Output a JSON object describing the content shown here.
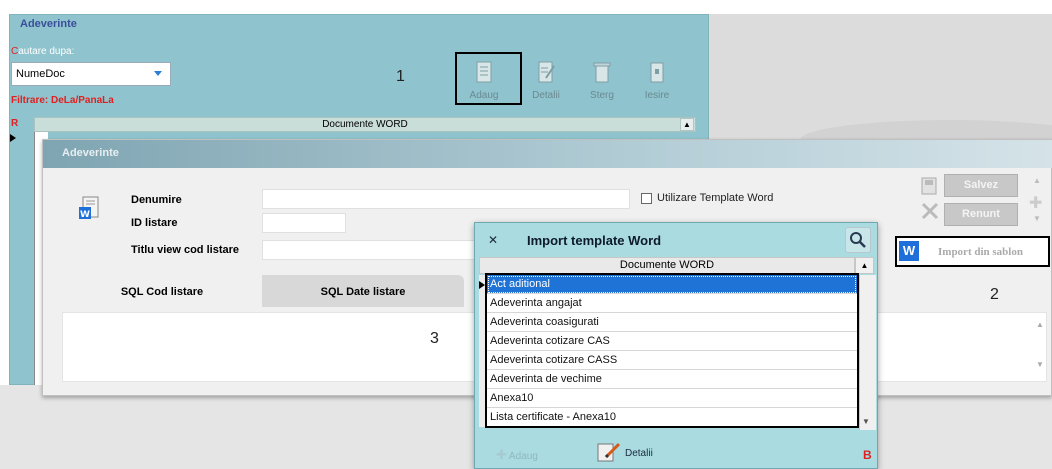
{
  "back_window": {
    "title": "Adeverinte",
    "search_label_first": "C",
    "search_label_rest": "autare dupa:",
    "search_value": "NumeDoc",
    "filter_label": "Filtrare: DeLa/PanaLa",
    "toolbar": {
      "adaug": "Adaug",
      "detalii": "Detalii",
      "sterg": "Sterg",
      "iesire": "Iesire"
    },
    "grid_marker": "R",
    "grid_header": "Documente WORD",
    "step_label": "1"
  },
  "front_window": {
    "title": "Adeverinte",
    "labels": {
      "denumire": "Denumire",
      "id_listare": "ID listare",
      "titlu_view": "Titlu view cod listare"
    },
    "checkbox_label": "Utilizare Template Word",
    "buttons": {
      "salvez": "Salvez",
      "renunt": "Renunt",
      "import": "Import din sablon",
      "import_icon_letter": "W"
    },
    "tabs": [
      "SQL Cod listare",
      "SQL Date listare"
    ],
    "step2_label": "2",
    "step3_label": "3"
  },
  "dialog": {
    "title": "Import template Word",
    "grid_header": "Documente WORD",
    "rows": [
      "Act aditional",
      "Adeverinta angajat",
      "Adeverinta coasigurati",
      "Adeverinta cotizare  CAS",
      "Adeverinta cotizare CASS",
      "Adeverinta de vechime",
      "Anexa10",
      "Lista certificate - Anexa10"
    ],
    "selected_row": 0,
    "footer": {
      "adaug": "Adaug",
      "detalii": "Detalii",
      "b_marker": "B"
    }
  },
  "colors": {
    "back_window_bg": "#8fc3cd",
    "dialog_bg": "#a9dbe1",
    "selection": "#1f73d6",
    "accent_red": "#e02020",
    "word_blue": "#1e6fd9"
  }
}
